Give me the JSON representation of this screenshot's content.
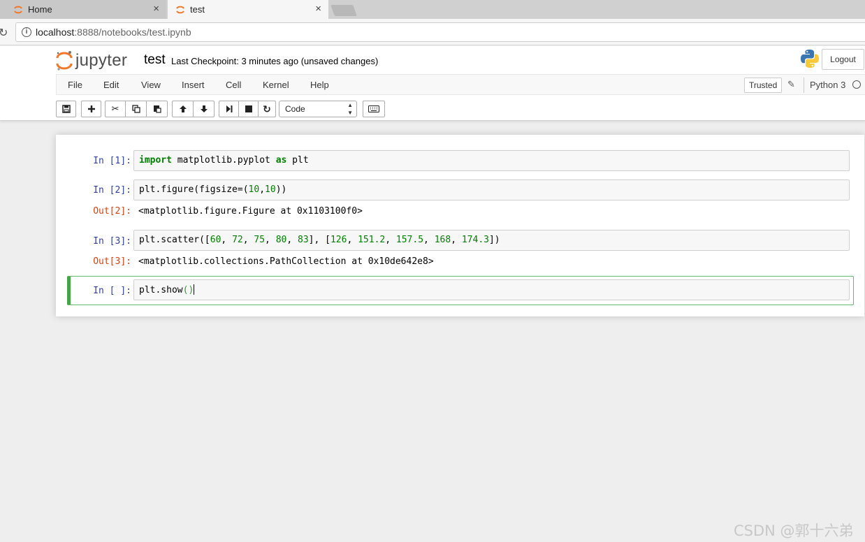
{
  "browser": {
    "tabs": [
      {
        "title": "Home",
        "active": false
      },
      {
        "title": "test",
        "active": true
      }
    ],
    "close_glyph": "×",
    "url_host": "localhost",
    "url_rest": ":8888/notebooks/test.ipynb"
  },
  "header": {
    "logo_text": "jupyter",
    "notebook_name": "test",
    "checkpoint": "Last Checkpoint: 3 minutes ago (unsaved changes)",
    "logout_label": "Logout"
  },
  "menubar": {
    "items": [
      "File",
      "Edit",
      "View",
      "Insert",
      "Cell",
      "Kernel",
      "Help"
    ],
    "trusted_label": "Trusted",
    "kernel_name": "Python 3"
  },
  "toolbar": {
    "cell_type": "Code",
    "icons": [
      "save-icon",
      "plus-icon",
      "cut-icon",
      "copy-icon",
      "paste-icon",
      "arrow-up-icon",
      "arrow-down-icon",
      "step-forward-icon",
      "stop-icon",
      "refresh-icon",
      "keyboard-icon"
    ]
  },
  "cells": [
    {
      "prompt": "In [1]:",
      "code": "import matplotlib.pyplot as plt"
    },
    {
      "prompt": "In [2]:",
      "code": "plt.figure(figsize=(10,10))",
      "out_prompt": "Out[2]:",
      "output": "<matplotlib.figure.Figure at 0x1103100f0>"
    },
    {
      "prompt": "In [3]:",
      "code": "plt.scatter([60, 72, 75, 80, 83], [126, 151.2, 157.5, 168, 174.3])",
      "out_prompt": "Out[3]:",
      "output": "<matplotlib.collections.PathCollection at 0x10de642e8>"
    },
    {
      "prompt": "In [ ]:",
      "code": "plt.show()"
    }
  ],
  "watermark": "CSDN @郭十六弟",
  "colors": {
    "in_prompt": "#303f9f",
    "out_prompt": "#d84315",
    "keyword": "#008000",
    "selected_border": "#42a548"
  }
}
